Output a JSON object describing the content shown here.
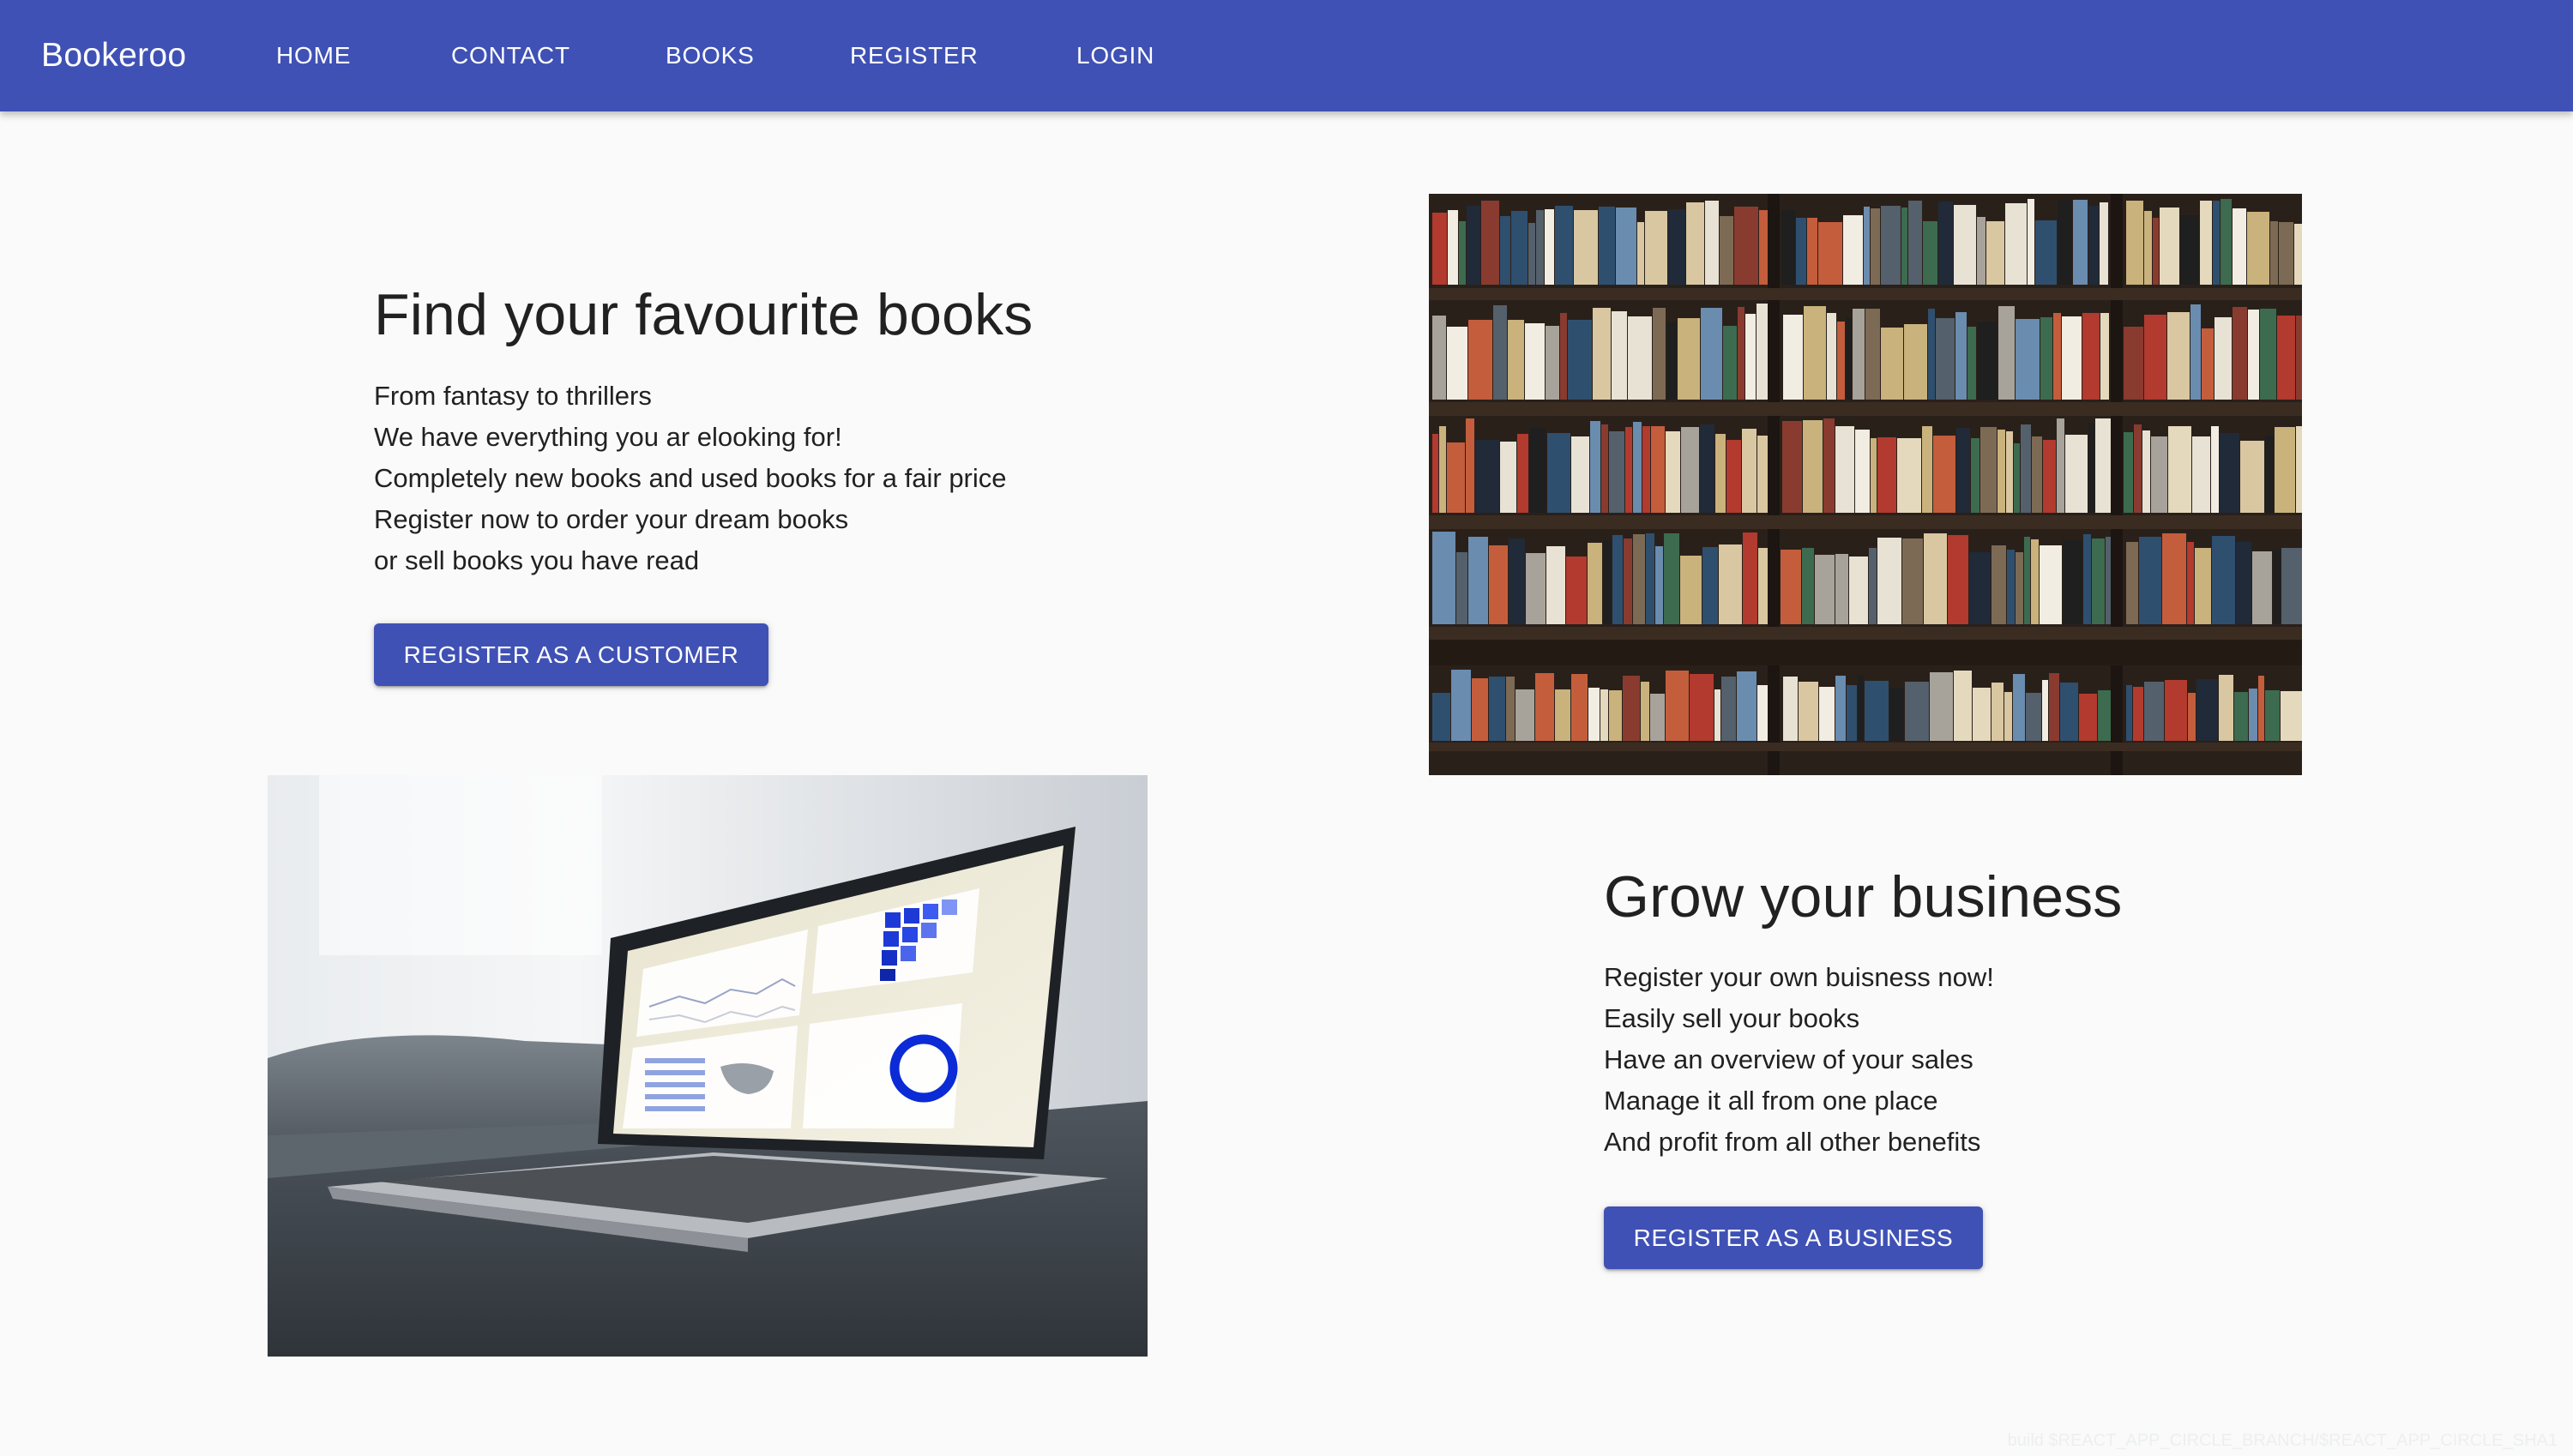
{
  "app": {
    "brand": "Bookeroo"
  },
  "nav": {
    "home": "HOME",
    "contact": "CONTACT",
    "books": "BOOKS",
    "register": "REGISTER",
    "login": "LOGIN"
  },
  "customer_section": {
    "title": "Find your favourite books",
    "lines": [
      "From fantasy to thrillers",
      "We have everything you ar elooking for!",
      "Completely new books and used books for a fair price",
      "Register now to order your dream books",
      "or sell books you have read"
    ],
    "button_label": "REGISTER AS A CUSTOMER",
    "image_icon": "bookshelf-photo"
  },
  "business_section": {
    "title": "Grow your business",
    "lines": [
      "Register your own buisness now!",
      "Easily sell your books",
      "Have an overview of your sales",
      "Manage it all from one place",
      "And profit from all other benefits"
    ],
    "button_label": "REGISTER AS A BUSINESS",
    "image_icon": "laptop-dashboard-photo"
  },
  "footer": {
    "build_text": "build $REACT_APP_CIRCLE_BRANCH/$REACT_APP_CIRCLE_SHA1"
  },
  "colors": {
    "primary": "#3f51b5",
    "background": "#fafafa",
    "text": "#212121"
  }
}
